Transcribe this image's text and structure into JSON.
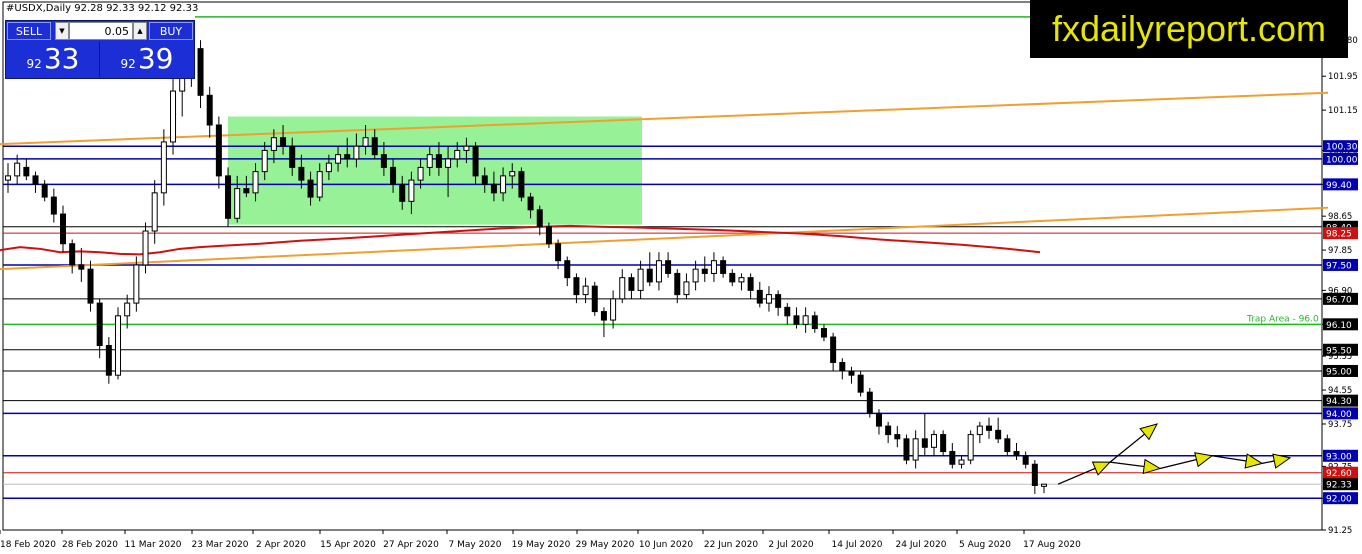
{
  "header": {
    "symbol_line": "#USDX,Daily  92.28 92.33 92.12 92.33"
  },
  "trade_panel": {
    "sell_label": "SELL",
    "buy_label": "BUY",
    "lot": "0.05",
    "bid_big": "92",
    "bid_small": "33",
    "ask_big": "92",
    "ask_small": "39"
  },
  "brand": "fxdailyreport.com",
  "colors": {
    "support_resistance": "#0000b0",
    "black_level": "#000000",
    "trap_line": "#22b822",
    "range_box": "#8cf08c",
    "trendline": "#f0a030",
    "moving_average": "#d01010",
    "arrow_fill": "#e6e600",
    "current_price": "#d01010"
  },
  "chart_data": {
    "type": "candlestick",
    "symbol": "#USDX",
    "timeframe": "Daily",
    "ylim": [
      91.25,
      103.7
    ],
    "y_ticks": [
      91.25,
      92.0,
      92.75,
      93.75,
      94.55,
      95.35,
      96.1,
      96.9,
      97.85,
      98.65,
      99.4,
      100.2,
      101.15,
      101.95,
      102.8
    ],
    "x_labels": [
      "18 Feb 2020",
      "28 Feb 2020",
      "11 Mar 2020",
      "23 Mar 2020",
      "2 Apr 2020",
      "15 Apr 2020",
      "27 Apr 2020",
      "7 May 2020",
      "19 May 2020",
      "29 May 2020",
      "10 Jun 2020",
      "22 Jun 2020",
      "2 Jul 2020",
      "14 Jul 2020",
      "24 Jul 2020",
      "5 Aug 2020",
      "17 Aug 2020"
    ],
    "horizontal_levels": [
      {
        "value": 100.3,
        "label": "100.30",
        "style": "blue"
      },
      {
        "value": 100.0,
        "label": "100.00",
        "style": "blue"
      },
      {
        "value": 99.4,
        "label": "99.40",
        "style": "blue"
      },
      {
        "value": 98.4,
        "label": "98.40",
        "style": "black"
      },
      {
        "value": 98.25,
        "label": "98.25",
        "style": "red-thin"
      },
      {
        "value": 97.5,
        "label": "97.50",
        "style": "blue"
      },
      {
        "value": 96.7,
        "label": "96.70",
        "style": "black"
      },
      {
        "value": 96.1,
        "label": "96.10",
        "style": "green"
      },
      {
        "value": 95.5,
        "label": "95.50",
        "style": "black"
      },
      {
        "value": 95.0,
        "label": "95.00",
        "style": "black"
      },
      {
        "value": 94.3,
        "label": "94.30",
        "style": "black"
      },
      {
        "value": 94.0,
        "label": "94.00",
        "style": "blue"
      },
      {
        "value": 93.0,
        "label": "93.00",
        "style": "blue"
      },
      {
        "value": 92.6,
        "label": "92.60",
        "style": "red"
      },
      {
        "value": 92.33,
        "label": "92.33",
        "style": "current"
      },
      {
        "value": 92.0,
        "label": "92.00",
        "style": "blue"
      }
    ],
    "trap_label": "Trap Area - 96.0",
    "candles": [
      {
        "o": 99.5,
        "h": 99.9,
        "l": 99.2,
        "c": 99.6
      },
      {
        "o": 99.6,
        "h": 100.1,
        "l": 99.4,
        "c": 99.9
      },
      {
        "o": 99.8,
        "h": 100.0,
        "l": 99.5,
        "c": 99.6
      },
      {
        "o": 99.6,
        "h": 99.7,
        "l": 99.2,
        "c": 99.4
      },
      {
        "o": 99.4,
        "h": 99.5,
        "l": 99.0,
        "c": 99.1
      },
      {
        "o": 99.1,
        "h": 99.3,
        "l": 98.5,
        "c": 98.7
      },
      {
        "o": 98.7,
        "h": 98.9,
        "l": 97.8,
        "c": 98.0
      },
      {
        "o": 98.0,
        "h": 98.1,
        "l": 97.3,
        "c": 97.5
      },
      {
        "o": 97.5,
        "h": 97.9,
        "l": 97.1,
        "c": 97.4
      },
      {
        "o": 97.4,
        "h": 97.6,
        "l": 96.4,
        "c": 96.6
      },
      {
        "o": 96.6,
        "h": 96.7,
        "l": 95.3,
        "c": 95.6
      },
      {
        "o": 95.6,
        "h": 95.8,
        "l": 94.7,
        "c": 94.9
      },
      {
        "o": 94.9,
        "h": 96.5,
        "l": 94.8,
        "c": 96.3
      },
      {
        "o": 96.3,
        "h": 96.8,
        "l": 96.0,
        "c": 96.6
      },
      {
        "o": 96.6,
        "h": 97.7,
        "l": 96.4,
        "c": 97.5
      },
      {
        "o": 97.5,
        "h": 98.5,
        "l": 97.3,
        "c": 98.3
      },
      {
        "o": 98.3,
        "h": 99.5,
        "l": 98.0,
        "c": 99.2
      },
      {
        "o": 99.2,
        "h": 100.7,
        "l": 98.9,
        "c": 100.4
      },
      {
        "o": 100.4,
        "h": 101.9,
        "l": 100.1,
        "c": 101.6
      },
      {
        "o": 101.6,
        "h": 102.4,
        "l": 101.0,
        "c": 102.1
      },
      {
        "o": 102.1,
        "h": 103.0,
        "l": 101.7,
        "c": 102.6
      },
      {
        "o": 102.6,
        "h": 102.8,
        "l": 101.2,
        "c": 101.5
      },
      {
        "o": 101.5,
        "h": 101.7,
        "l": 100.5,
        "c": 100.8
      },
      {
        "o": 100.8,
        "h": 101.0,
        "l": 99.3,
        "c": 99.6
      },
      {
        "o": 99.6,
        "h": 99.8,
        "l": 98.4,
        "c": 98.6
      },
      {
        "o": 98.6,
        "h": 99.6,
        "l": 98.5,
        "c": 99.3
      },
      {
        "o": 99.3,
        "h": 99.6,
        "l": 99.1,
        "c": 99.2
      },
      {
        "o": 99.2,
        "h": 99.9,
        "l": 99.0,
        "c": 99.7
      },
      {
        "o": 99.7,
        "h": 100.4,
        "l": 99.5,
        "c": 100.2
      },
      {
        "o": 100.2,
        "h": 100.7,
        "l": 99.9,
        "c": 100.5
      },
      {
        "o": 100.5,
        "h": 100.8,
        "l": 100.1,
        "c": 100.3
      },
      {
        "o": 100.3,
        "h": 100.5,
        "l": 99.6,
        "c": 99.8
      },
      {
        "o": 99.8,
        "h": 100.1,
        "l": 99.3,
        "c": 99.5
      },
      {
        "o": 99.5,
        "h": 99.7,
        "l": 98.9,
        "c": 99.1
      },
      {
        "o": 99.1,
        "h": 99.9,
        "l": 99.0,
        "c": 99.7
      },
      {
        "o": 99.7,
        "h": 100.1,
        "l": 99.5,
        "c": 99.9
      },
      {
        "o": 99.9,
        "h": 100.3,
        "l": 99.7,
        "c": 100.1
      },
      {
        "o": 100.1,
        "h": 100.5,
        "l": 99.8,
        "c": 100.0
      },
      {
        "o": 100.0,
        "h": 100.6,
        "l": 99.8,
        "c": 100.3
      },
      {
        "o": 100.3,
        "h": 100.8,
        "l": 100.1,
        "c": 100.5
      },
      {
        "o": 100.5,
        "h": 100.7,
        "l": 100.0,
        "c": 100.1
      },
      {
        "o": 100.1,
        "h": 100.4,
        "l": 99.6,
        "c": 99.8
      },
      {
        "o": 99.8,
        "h": 100.0,
        "l": 99.2,
        "c": 99.4
      },
      {
        "o": 99.4,
        "h": 99.6,
        "l": 98.8,
        "c": 99.0
      },
      {
        "o": 99.0,
        "h": 99.7,
        "l": 98.7,
        "c": 99.5
      },
      {
        "o": 99.5,
        "h": 100.0,
        "l": 99.3,
        "c": 99.8
      },
      {
        "o": 99.8,
        "h": 100.3,
        "l": 99.6,
        "c": 100.1
      },
      {
        "o": 100.1,
        "h": 100.4,
        "l": 99.6,
        "c": 99.8
      },
      {
        "o": 99.8,
        "h": 100.3,
        "l": 99.1,
        "c": 100.0
      },
      {
        "o": 100.0,
        "h": 100.4,
        "l": 99.8,
        "c": 100.2
      },
      {
        "o": 100.2,
        "h": 100.5,
        "l": 99.9,
        "c": 100.3
      },
      {
        "o": 100.3,
        "h": 100.4,
        "l": 99.4,
        "c": 99.6
      },
      {
        "o": 99.6,
        "h": 99.8,
        "l": 99.2,
        "c": 99.4
      },
      {
        "o": 99.4,
        "h": 99.7,
        "l": 99.0,
        "c": 99.2
      },
      {
        "o": 99.2,
        "h": 99.8,
        "l": 99.0,
        "c": 99.6
      },
      {
        "o": 99.6,
        "h": 99.9,
        "l": 99.3,
        "c": 99.7
      },
      {
        "o": 99.7,
        "h": 99.8,
        "l": 99.0,
        "c": 99.1
      },
      {
        "o": 99.1,
        "h": 99.2,
        "l": 98.6,
        "c": 98.8
      },
      {
        "o": 98.8,
        "h": 98.9,
        "l": 98.2,
        "c": 98.4
      },
      {
        "o": 98.4,
        "h": 98.5,
        "l": 97.9,
        "c": 98.0
      },
      {
        "o": 98.0,
        "h": 98.1,
        "l": 97.4,
        "c": 97.6
      },
      {
        "o": 97.6,
        "h": 97.7,
        "l": 97.0,
        "c": 97.2
      },
      {
        "o": 97.2,
        "h": 97.3,
        "l": 96.6,
        "c": 96.8
      },
      {
        "o": 96.8,
        "h": 97.2,
        "l": 96.6,
        "c": 97.0
      },
      {
        "o": 97.0,
        "h": 97.1,
        "l": 96.3,
        "c": 96.4
      },
      {
        "o": 96.4,
        "h": 96.5,
        "l": 95.8,
        "c": 96.2
      },
      {
        "o": 96.2,
        "h": 96.9,
        "l": 96.0,
        "c": 96.7
      },
      {
        "o": 96.7,
        "h": 97.4,
        "l": 96.6,
        "c": 97.2
      },
      {
        "o": 97.2,
        "h": 97.3,
        "l": 96.7,
        "c": 96.9
      },
      {
        "o": 96.9,
        "h": 97.6,
        "l": 96.7,
        "c": 97.4
      },
      {
        "o": 97.4,
        "h": 97.8,
        "l": 97.0,
        "c": 97.1
      },
      {
        "o": 97.1,
        "h": 97.8,
        "l": 96.9,
        "c": 97.6
      },
      {
        "o": 97.6,
        "h": 97.8,
        "l": 97.2,
        "c": 97.3
      },
      {
        "o": 97.3,
        "h": 97.4,
        "l": 96.6,
        "c": 96.8
      },
      {
        "o": 96.8,
        "h": 97.3,
        "l": 96.7,
        "c": 97.1
      },
      {
        "o": 97.1,
        "h": 97.6,
        "l": 96.9,
        "c": 97.4
      },
      {
        "o": 97.4,
        "h": 97.7,
        "l": 97.1,
        "c": 97.3
      },
      {
        "o": 97.3,
        "h": 97.8,
        "l": 97.1,
        "c": 97.6
      },
      {
        "o": 97.6,
        "h": 97.7,
        "l": 97.2,
        "c": 97.3
      },
      {
        "o": 97.3,
        "h": 97.4,
        "l": 97.0,
        "c": 97.1
      },
      {
        "o": 97.1,
        "h": 97.3,
        "l": 96.9,
        "c": 97.2
      },
      {
        "o": 97.2,
        "h": 97.3,
        "l": 96.7,
        "c": 96.9
      },
      {
        "o": 96.9,
        "h": 97.1,
        "l": 96.5,
        "c": 96.6
      },
      {
        "o": 96.6,
        "h": 97.0,
        "l": 96.4,
        "c": 96.8
      },
      {
        "o": 96.8,
        "h": 96.9,
        "l": 96.3,
        "c": 96.5
      },
      {
        "o": 96.5,
        "h": 96.6,
        "l": 96.1,
        "c": 96.3
      },
      {
        "o": 96.3,
        "h": 96.5,
        "l": 96.0,
        "c": 96.1
      },
      {
        "o": 96.1,
        "h": 96.5,
        "l": 95.9,
        "c": 96.3
      },
      {
        "o": 96.3,
        "h": 96.4,
        "l": 95.9,
        "c": 96.0
      },
      {
        "o": 96.0,
        "h": 96.1,
        "l": 95.7,
        "c": 95.8
      },
      {
        "o": 95.8,
        "h": 95.9,
        "l": 95.0,
        "c": 95.2
      },
      {
        "o": 95.2,
        "h": 95.3,
        "l": 94.8,
        "c": 95.0
      },
      {
        "o": 95.0,
        "h": 95.1,
        "l": 94.7,
        "c": 94.9
      },
      {
        "o": 94.9,
        "h": 95.0,
        "l": 94.4,
        "c": 94.5
      },
      {
        "o": 94.5,
        "h": 94.6,
        "l": 93.9,
        "c": 94.0
      },
      {
        "o": 94.0,
        "h": 94.1,
        "l": 93.5,
        "c": 93.7
      },
      {
        "o": 93.7,
        "h": 93.8,
        "l": 93.3,
        "c": 93.5
      },
      {
        "o": 93.5,
        "h": 93.7,
        "l": 93.2,
        "c": 93.4
      },
      {
        "o": 93.4,
        "h": 93.5,
        "l": 92.8,
        "c": 92.9
      },
      {
        "o": 92.9,
        "h": 93.6,
        "l": 92.7,
        "c": 93.4
      },
      {
        "o": 93.4,
        "h": 94.0,
        "l": 93.0,
        "c": 93.2
      },
      {
        "o": 93.2,
        "h": 93.6,
        "l": 93.0,
        "c": 93.5
      },
      {
        "o": 93.5,
        "h": 93.6,
        "l": 93.0,
        "c": 93.1
      },
      {
        "o": 93.1,
        "h": 93.3,
        "l": 92.7,
        "c": 92.8
      },
      {
        "o": 92.8,
        "h": 93.0,
        "l": 92.7,
        "c": 92.9
      },
      {
        "o": 92.9,
        "h": 93.6,
        "l": 92.8,
        "c": 93.5
      },
      {
        "o": 93.5,
        "h": 93.8,
        "l": 93.3,
        "c": 93.7
      },
      {
        "o": 93.7,
        "h": 93.9,
        "l": 93.4,
        "c": 93.6
      },
      {
        "o": 93.6,
        "h": 93.9,
        "l": 93.3,
        "c": 93.4
      },
      {
        "o": 93.4,
        "h": 93.5,
        "l": 93.0,
        "c": 93.1
      },
      {
        "o": 93.1,
        "h": 93.3,
        "l": 92.9,
        "c": 93.0
      },
      {
        "o": 93.0,
        "h": 93.1,
        "l": 92.7,
        "c": 92.8
      },
      {
        "o": 92.8,
        "h": 92.9,
        "l": 92.1,
        "c": 92.3
      },
      {
        "o": 92.28,
        "h": 92.33,
        "l": 92.12,
        "c": 92.33
      }
    ],
    "moving_average": [
      [
        0,
        97.85
      ],
      [
        20,
        97.92
      ],
      [
        40,
        97.88
      ],
      [
        60,
        97.8
      ],
      [
        80,
        97.82
      ],
      [
        100,
        97.8
      ],
      [
        120,
        97.76
      ],
      [
        140,
        97.75
      ],
      [
        160,
        97.8
      ],
      [
        180,
        97.88
      ],
      [
        200,
        97.92
      ],
      [
        220,
        97.95
      ],
      [
        260,
        98.0
      ],
      [
        300,
        98.07
      ],
      [
        340,
        98.12
      ],
      [
        380,
        98.18
      ],
      [
        420,
        98.24
      ],
      [
        460,
        98.3
      ],
      [
        500,
        98.36
      ],
      [
        540,
        98.4
      ],
      [
        570,
        98.42
      ],
      [
        600,
        98.4
      ],
      [
        640,
        98.38
      ],
      [
        680,
        98.35
      ],
      [
        720,
        98.32
      ],
      [
        760,
        98.28
      ],
      [
        800,
        98.24
      ],
      [
        840,
        98.18
      ],
      [
        880,
        98.1
      ],
      [
        920,
        98.04
      ],
      [
        960,
        97.98
      ],
      [
        1000,
        97.9
      ],
      [
        1040,
        97.8
      ]
    ],
    "trendlines": [
      {
        "x1": 0,
        "y1": 100.35,
        "x2": 1328,
        "y2": 101.56
      },
      {
        "x1": 0,
        "y1": 97.4,
        "x2": 1328,
        "y2": 98.85
      }
    ],
    "range_box": {
      "x1": 228,
      "x2": 642,
      "y_top": 101.0,
      "y_bottom": 98.45
    },
    "top_level": {
      "value": 103.35,
      "x1": 195,
      "x2": 1328
    },
    "projection_path": [
      [
        1058,
        92.33
      ],
      [
        1110,
        92.85
      ],
      [
        1110,
        92.85
      ],
      [
        1160,
        92.7
      ],
      [
        1190,
        92.95
      ],
      [
        1212,
        93.0
      ],
      [
        1238,
        92.75
      ],
      [
        1262,
        92.82
      ],
      [
        1290,
        92.95
      ]
    ]
  }
}
